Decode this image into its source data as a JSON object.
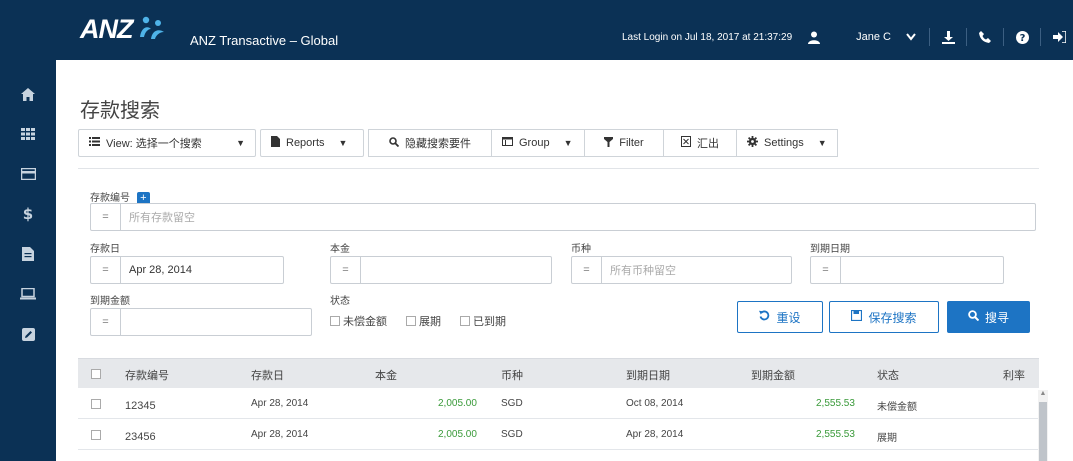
{
  "header": {
    "brand": "ANZ",
    "app_title": "ANZ Transactive – Global",
    "last_login": "Last Login on Jul 18, 2017 at 21:37:29",
    "user_name": "Jane C"
  },
  "sidebar": {
    "items": [
      "home-icon",
      "grid-icon",
      "card-icon",
      "dollar-icon",
      "document-icon",
      "laptop-icon",
      "edit-icon"
    ]
  },
  "page": {
    "title": "存款搜索"
  },
  "toolbar": {
    "view_label": "View: 选择一个搜索",
    "reports_label": "Reports",
    "hide_search_label": "隐藏搜索要件",
    "group_label": "Group",
    "filter_label": "Filter",
    "export_label": "汇出",
    "settings_label": "Settings"
  },
  "search": {
    "deposit_no_label": "存款编号",
    "deposit_no_op": "=",
    "deposit_no_placeholder": "所有存款留空",
    "deposit_date_label": "存款日",
    "deposit_date_op": "=",
    "deposit_date_value": "Apr 28, 2014",
    "principal_label": "本金",
    "principal_op": "=",
    "currency_label": "币种",
    "currency_op": "=",
    "currency_placeholder": "所有币种留空",
    "maturity_date_label": "到期日期",
    "maturity_date_op": "=",
    "maturity_amount_label": "到期金额",
    "maturity_amount_op": "=",
    "status_label": "状态",
    "status_options": [
      "未偿金额",
      "展期",
      "已到期"
    ],
    "reset_label": "重设",
    "save_label": "保存搜索",
    "search_label": "搜寻"
  },
  "table": {
    "columns": [
      "存款编号",
      "存款日",
      "本金",
      "币种",
      "到期日期",
      "到期金额",
      "状态",
      "利率"
    ],
    "rows": [
      {
        "id": "12345",
        "date": "Apr 28, 2014",
        "principal": "2,005.00",
        "currency": "SGD",
        "maturity": "Oct 08, 2014",
        "amount": "2,555.53",
        "status": "未偿金额"
      },
      {
        "id": "23456",
        "date": "Apr 28, 2014",
        "principal": "2,005.00",
        "currency": "SGD",
        "maturity": "Apr 28, 2014",
        "amount": "2,555.53",
        "status": "展期"
      }
    ]
  },
  "colors": {
    "navy": "#0b3155",
    "accent_blue": "#1d74c4",
    "amount_green": "#3a9a3a"
  }
}
